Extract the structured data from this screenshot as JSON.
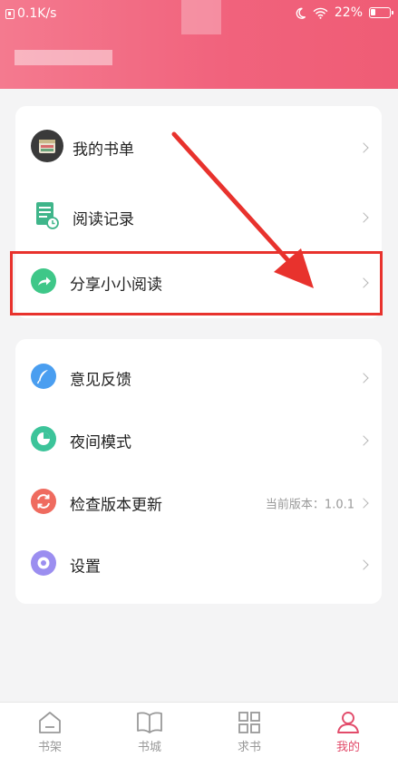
{
  "status_bar": {
    "speed": "0.1K/s",
    "battery": "22%"
  },
  "menu_group1": [
    {
      "label": "我的书单"
    },
    {
      "label": "阅读记录"
    },
    {
      "label": "分享小小阅读"
    }
  ],
  "menu_group2": [
    {
      "label": "意见反馈"
    },
    {
      "label": "夜间模式"
    },
    {
      "label": "检查版本更新",
      "extra": "当前版本：1.0.1"
    },
    {
      "label": "设置"
    }
  ],
  "tabs": [
    {
      "label": "书架",
      "icon": "home-icon"
    },
    {
      "label": "书城",
      "icon": "book-icon"
    },
    {
      "label": "求书",
      "icon": "grid-icon"
    },
    {
      "label": "我的",
      "icon": "person-icon",
      "active": true
    }
  ],
  "colors": {
    "header": "#f1637d",
    "accent": "#e24b6a",
    "annotation_red": "#e8322d"
  }
}
